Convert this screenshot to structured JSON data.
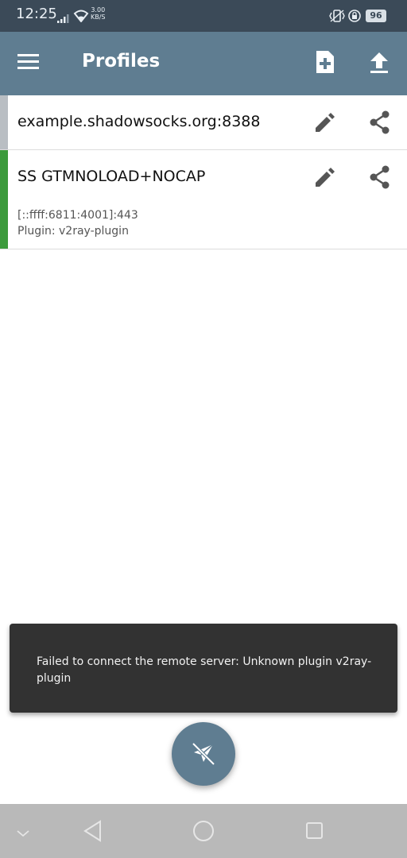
{
  "status_bar": {
    "time": "12:25",
    "network_speed_value": "3.00",
    "network_speed_unit": "KB/S",
    "battery": "96",
    "icons": [
      "signal-icon",
      "wifi-icon",
      "vibrate-icon",
      "rotation-lock-icon",
      "battery-icon"
    ]
  },
  "toolbar": {
    "title": "Profiles",
    "menu_icon": "hamburger-menu-icon",
    "add_icon": "new-file-icon",
    "upload_icon": "upload-icon"
  },
  "profiles": [
    {
      "name": "example.shadowsocks.org:8388",
      "detail_lines": [],
      "selected": false
    },
    {
      "name": "SS GTMNOLOAD+NOCAP",
      "detail_lines": [
        "[::ffff:6811:4001]:443",
        "Plugin: v2ray-plugin"
      ],
      "selected": true
    }
  ],
  "snackbar": {
    "message": "Failed to connect the remote server: Unknown plugin v2ray-plugin"
  },
  "fab": {
    "icon": "plane-off-icon"
  },
  "colors": {
    "status_bar": "#3b4a58",
    "toolbar": "#5f7d91",
    "selected_indicator": "#3c9a3c",
    "unselected_indicator": "#b9bec3",
    "snackbar": "#323232",
    "nav_bar": "#b9b9b9"
  }
}
